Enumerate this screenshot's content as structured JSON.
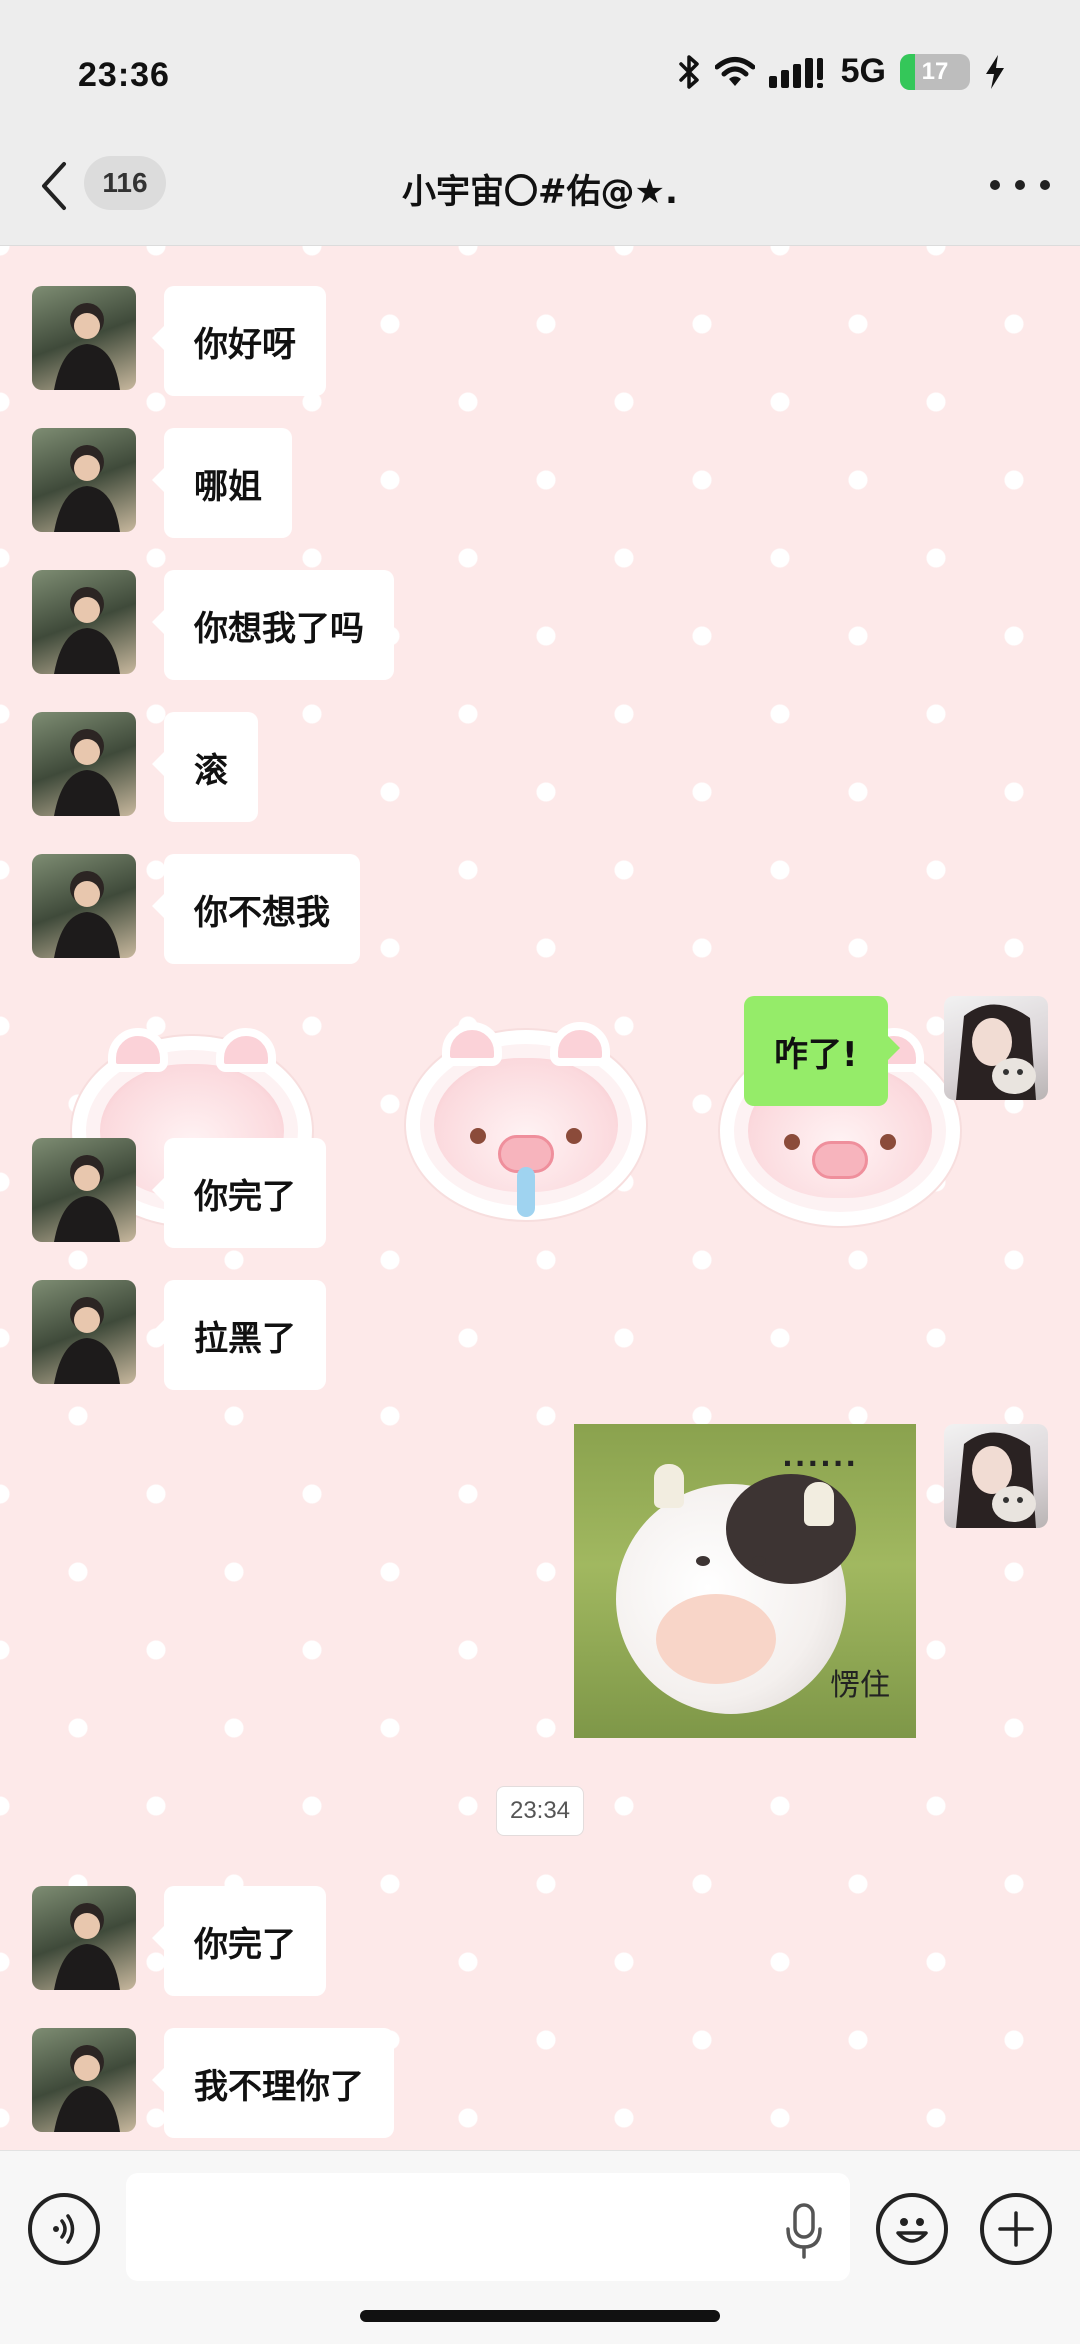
{
  "status_bar": {
    "time": "23:36",
    "network": "5G",
    "battery_level": "17",
    "icons": [
      "bluetooth-icon",
      "wifi-icon",
      "signal-icon",
      "battery-icon",
      "charging-icon"
    ]
  },
  "nav": {
    "unread_count": "116",
    "title": "小宇宙〇#佑@★.",
    "back_icon": "chevron-left-icon",
    "more_icon": "more-dots-icon"
  },
  "messages": [
    {
      "side": "left",
      "text": "你好呀"
    },
    {
      "side": "left",
      "text": "哪姐"
    },
    {
      "side": "left",
      "text": "你想我了吗"
    },
    {
      "side": "left",
      "text": "滚"
    },
    {
      "side": "left",
      "text": "你不想我"
    },
    {
      "side": "right",
      "text": "咋了!"
    },
    {
      "side": "left",
      "text": "你完了"
    },
    {
      "side": "left",
      "text": "拉黑了"
    },
    {
      "side": "right",
      "type": "sticker",
      "dots": "......",
      "caption": "愣住"
    },
    {
      "side": "left",
      "text": "你完了"
    },
    {
      "side": "left",
      "text": "我不理你了"
    }
  ],
  "timestamp": "23:34",
  "input": {
    "placeholder": "",
    "voice_icon": "voice-input-icon",
    "mic_icon": "microphone-icon",
    "emoji_icon": "emoji-icon",
    "plus_icon": "plus-icon"
  },
  "colors": {
    "chat_background": "#fde9e9",
    "my_bubble": "#95ec69",
    "their_bubble": "#ffffff",
    "bar_background": "#ededed"
  }
}
